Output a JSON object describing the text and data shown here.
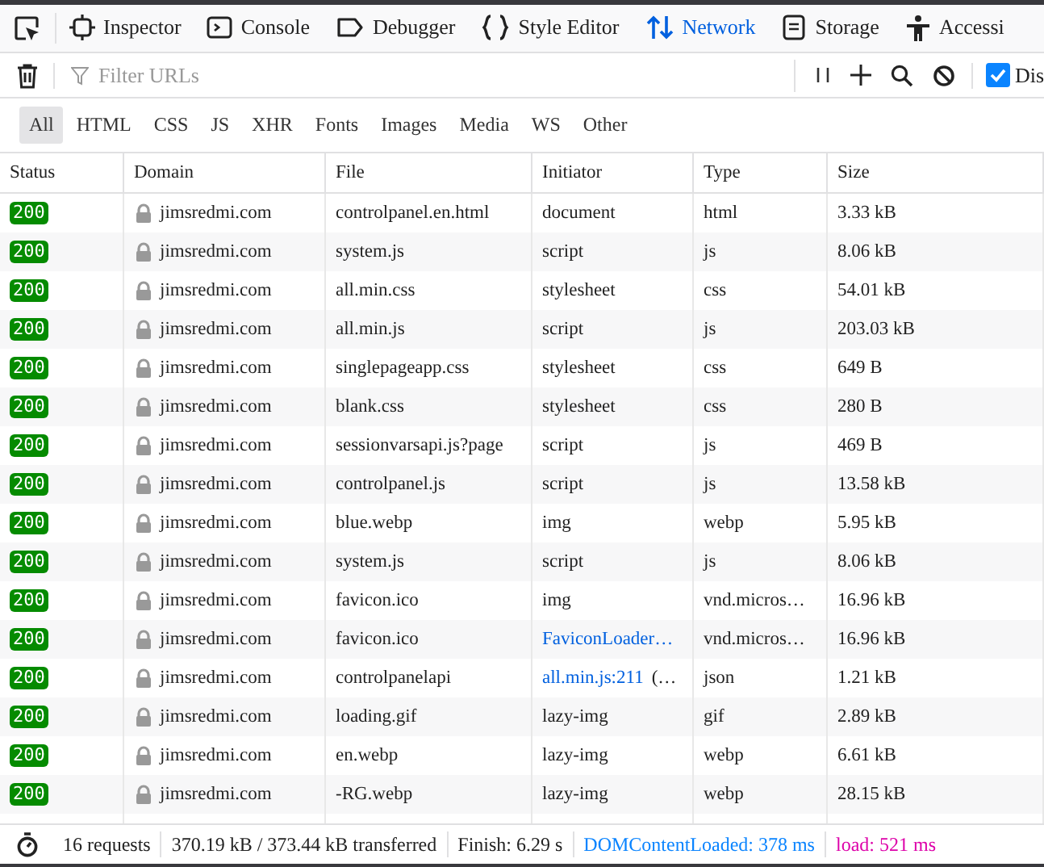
{
  "tabs": [
    {
      "kind": "inspector",
      "label": "Inspector",
      "selected": false
    },
    {
      "kind": "console",
      "label": "Console",
      "selected": false
    },
    {
      "kind": "debugger",
      "label": "Debugger",
      "selected": false
    },
    {
      "kind": "style",
      "label": "Style Editor",
      "selected": false
    },
    {
      "kind": "network",
      "label": "Network",
      "selected": true
    },
    {
      "kind": "storage",
      "label": "Storage",
      "selected": false
    },
    {
      "kind": "accessibility",
      "label": "Accessi",
      "selected": false
    }
  ],
  "filter": {
    "placeholder": "Filter URLs"
  },
  "disable_cache": {
    "label": "Dis",
    "checked": true
  },
  "type_filters": [
    {
      "label": "All",
      "selected": true
    },
    {
      "label": "HTML",
      "selected": false
    },
    {
      "label": "CSS",
      "selected": false
    },
    {
      "label": "JS",
      "selected": false
    },
    {
      "label": "XHR",
      "selected": false
    },
    {
      "label": "Fonts",
      "selected": false
    },
    {
      "label": "Images",
      "selected": false
    },
    {
      "label": "Media",
      "selected": false
    },
    {
      "label": "WS",
      "selected": false
    },
    {
      "label": "Other",
      "selected": false
    }
  ],
  "table": {
    "columns": [
      "Status",
      "Domain",
      "File",
      "Initiator",
      "Type",
      "Size"
    ],
    "rows": [
      {
        "status": "200",
        "domain": "jimsredmi.com",
        "file": "controlpanel.en.html",
        "initiator": "document",
        "initiator_link": false,
        "type": "html",
        "size": "3.33 kB"
      },
      {
        "status": "200",
        "domain": "jimsredmi.com",
        "file": "system.js",
        "initiator": "script",
        "initiator_link": false,
        "type": "js",
        "size": "8.06 kB"
      },
      {
        "status": "200",
        "domain": "jimsredmi.com",
        "file": "all.min.css",
        "initiator": "stylesheet",
        "initiator_link": false,
        "type": "css",
        "size": "54.01 kB"
      },
      {
        "status": "200",
        "domain": "jimsredmi.com",
        "file": "all.min.js",
        "initiator": "script",
        "initiator_link": false,
        "type": "js",
        "size": "203.03 kB"
      },
      {
        "status": "200",
        "domain": "jimsredmi.com",
        "file": "singlepageapp.css",
        "initiator": "stylesheet",
        "initiator_link": false,
        "type": "css",
        "size": "649 B"
      },
      {
        "status": "200",
        "domain": "jimsredmi.com",
        "file": "blank.css",
        "initiator": "stylesheet",
        "initiator_link": false,
        "type": "css",
        "size": "280 B"
      },
      {
        "status": "200",
        "domain": "jimsredmi.com",
        "file": "sessionvarsapi.js?page",
        "initiator": "script",
        "initiator_link": false,
        "type": "js",
        "size": "469 B"
      },
      {
        "status": "200",
        "domain": "jimsredmi.com",
        "file": "controlpanel.js",
        "initiator": "script",
        "initiator_link": false,
        "type": "js",
        "size": "13.58 kB"
      },
      {
        "status": "200",
        "domain": "jimsredmi.com",
        "file": "blue.webp",
        "initiator": "img",
        "initiator_link": false,
        "type": "webp",
        "size": "5.95 kB"
      },
      {
        "status": "200",
        "domain": "jimsredmi.com",
        "file": "system.js",
        "initiator": "script",
        "initiator_link": false,
        "type": "js",
        "size": "8.06 kB"
      },
      {
        "status": "200",
        "domain": "jimsredmi.com",
        "file": "favicon.ico",
        "initiator": "img",
        "initiator_link": false,
        "type": "vnd.micros…",
        "size": "16.96 kB"
      },
      {
        "status": "200",
        "domain": "jimsredmi.com",
        "file": "favicon.ico",
        "initiator": "FaviconLoader…",
        "initiator_link": true,
        "type": "vnd.micros…",
        "size": "16.96 kB"
      },
      {
        "status": "200",
        "domain": "jimsredmi.com",
        "file": "controlpanelapi",
        "initiator": "all.min.js:211",
        "initiator_link": true,
        "initiator_note": "(…",
        "type": "json",
        "size": "1.21 kB"
      },
      {
        "status": "200",
        "domain": "jimsredmi.com",
        "file": "loading.gif",
        "initiator": "lazy-img",
        "initiator_link": false,
        "type": "gif",
        "size": "2.89 kB"
      },
      {
        "status": "200",
        "domain": "jimsredmi.com",
        "file": "en.webp",
        "initiator": "lazy-img",
        "initiator_link": false,
        "type": "webp",
        "size": "6.61 kB"
      },
      {
        "status": "200",
        "domain": "jimsredmi.com",
        "file": "-RG.webp",
        "initiator": "lazy-img",
        "initiator_link": false,
        "type": "webp",
        "size": "28.15 kB"
      }
    ]
  },
  "status_bar": [
    {
      "kind": "plain",
      "text": "16 requests"
    },
    {
      "kind": "plain",
      "text": "370.19 kB / 373.44 kB transferred"
    },
    {
      "kind": "plain",
      "text": "Finish: 6.29 s"
    },
    {
      "kind": "dom",
      "text": "DOMContentLoaded: 378 ms"
    },
    {
      "kind": "load",
      "text": "load: 521 ms"
    }
  ]
}
